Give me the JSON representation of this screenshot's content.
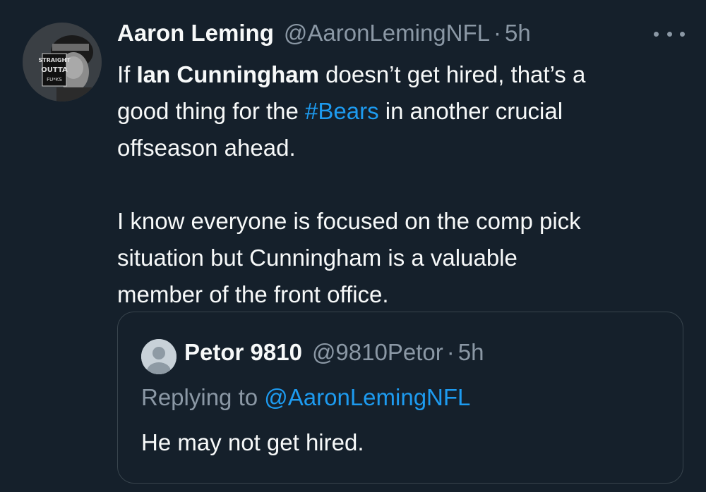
{
  "author": {
    "name": "Aaron Leming",
    "handle": "@AaronLemingNFL",
    "separator": "·",
    "time": "5h",
    "avatar_text": [
      "STRAIGHT",
      "OUTTA",
      "FU*KS"
    ]
  },
  "more_icon": "more-horizontal-icon",
  "tweet": {
    "line1_pre": "If ",
    "line1_bold": "Ian Cunningham",
    "line1_post": " doesn’t get hired, that’s a",
    "line2_pre": "good thing for the ",
    "line2_hashtag": "#Bears",
    "line2_post": " in another crucial",
    "line3": "offseason ahead.",
    "para2_line1": "I know everyone is focused on the comp pick",
    "para2_line2": "situation but Cunningham is a valuable",
    "para2_line3": "member of the front office."
  },
  "quote": {
    "name": "Petor 9810",
    "handle": "@9810Petor",
    "separator": "·",
    "time": "5h",
    "replying_prefix": "Replying to ",
    "replying_mention": "@AaronLemingNFL",
    "text": "He may not get hired."
  },
  "colors": {
    "background": "#15202b",
    "text": "#f7f9f9",
    "secondary": "#8b98a5",
    "link": "#1d9bf0",
    "border": "#38444d"
  }
}
